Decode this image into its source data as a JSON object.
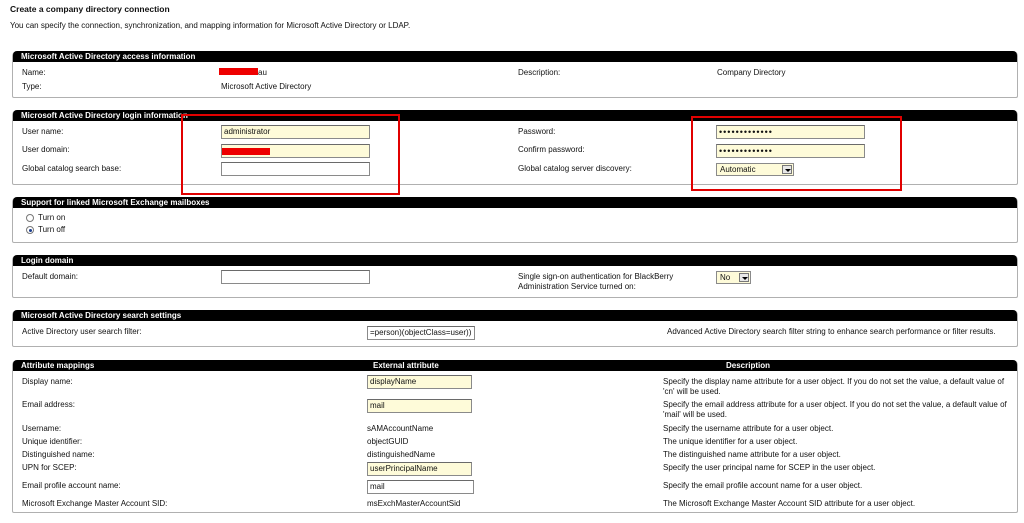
{
  "page": {
    "title": "Create a company directory connection",
    "intro": "You can specify the connection, synchronization, and mapping information for Microsoft Active Directory or LDAP."
  },
  "access": {
    "header": "Microsoft Active Directory access information",
    "name_label": "Name:",
    "name_value_visible": "au",
    "type_label": "Type:",
    "type_value": "Microsoft Active Directory",
    "description_label": "Description:",
    "description_value": "Company Directory"
  },
  "login": {
    "header": "Microsoft Active Directory login information",
    "user_name_label": "User name:",
    "user_name_value": "administrator",
    "user_domain_label": "User domain:",
    "search_base_label": "Global catalog search base:",
    "search_base_value": "",
    "password_label": "Password:",
    "password_value": "•••••••••••••",
    "confirm_label": "Confirm password:",
    "confirm_value": "•••••••••••••",
    "discovery_label": "Global catalog server discovery:",
    "discovery_value": "Automatic"
  },
  "exchange": {
    "header": "Support for linked Microsoft Exchange mailboxes",
    "turn_on": "Turn on",
    "turn_off": "Turn off"
  },
  "login_domain": {
    "header": "Login domain",
    "default_domain_label": "Default domain:",
    "default_domain_value": "",
    "sso_label_line1": "Single sign-on authentication for BlackBerry",
    "sso_label_line2": "Administration Service turned on:",
    "sso_value": "No"
  },
  "search": {
    "header": "Microsoft Active Directory search settings",
    "filter_label": "Active Directory user search filter:",
    "filter_value": "=person)(objectClass=user))",
    "filter_desc": "Advanced Active Directory search filter string to enhance search performance or filter results."
  },
  "mappings": {
    "header": "Attribute mappings",
    "col_external": "External attribute",
    "col_description": "Description",
    "rows": [
      {
        "label": "Display name:",
        "value": "displayName",
        "desc": "Specify the display name attribute for a user object. If you do not set the value, a default value of 'cn' will be used."
      },
      {
        "label": "Email address:",
        "value": "mail",
        "desc": "Specify the email address attribute for a user object. If you do not set the value, a default value of 'mail' will be used."
      },
      {
        "label": "Username:",
        "value": "sAMAccountName",
        "desc": "Specify the username attribute for a user object."
      },
      {
        "label": "Unique identifier:",
        "value": "objectGUID",
        "desc": "The unique identifier for a user object."
      },
      {
        "label": "Distinguished name:",
        "value": "distinguishedName",
        "desc": "The distinguished name attribute for a user object."
      },
      {
        "label": "UPN for SCEP:",
        "value": "userPrincipalName",
        "desc": "Specify the user principal name for SCEP in the user object."
      },
      {
        "label": "Email profile account name:",
        "value": "mail",
        "desc": "Specify the email profile account name for a user object."
      },
      {
        "label": "Microsoft Exchange Master Account SID:",
        "value": "msExchMasterAccountSid",
        "desc": "The Microsoft Exchange Master Account SID attribute for a user object."
      }
    ]
  },
  "colors": {
    "header_bg": "#000000",
    "input_bg": "#fefbd9",
    "annotation": "#e10000",
    "redaction": "#ee0000"
  }
}
